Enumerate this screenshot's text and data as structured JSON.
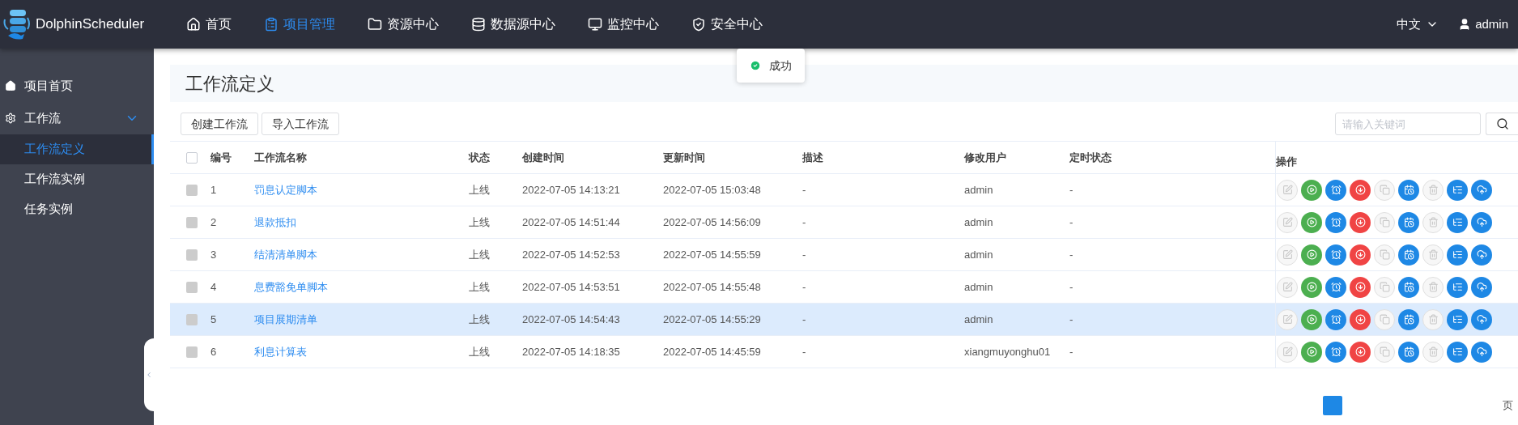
{
  "header": {
    "brand": "DolphinScheduler",
    "nav": [
      {
        "kind": "home",
        "label": "首页",
        "selected": false
      },
      {
        "kind": "project",
        "label": "项目管理",
        "selected": true
      },
      {
        "kind": "resource",
        "label": "资源中心",
        "selected": false
      },
      {
        "kind": "datasource",
        "label": "数据源中心",
        "selected": false
      },
      {
        "kind": "monitor",
        "label": "监控中心",
        "selected": false
      },
      {
        "kind": "security",
        "label": "安全中心",
        "selected": false
      }
    ],
    "language": "中文",
    "user": "admin"
  },
  "toast": {
    "kind": "success",
    "message": "成功"
  },
  "sidebar": {
    "items": [
      {
        "kind": "home",
        "label": "项目首页",
        "selected": false
      },
      {
        "kind": "gear",
        "label": "工作流",
        "expanded": true,
        "children": [
          {
            "label": "工作流定义",
            "selected": true
          },
          {
            "label": "工作流实例",
            "selected": false
          },
          {
            "label": "任务实例",
            "selected": false
          }
        ]
      }
    ]
  },
  "page": {
    "title": "工作流定义",
    "buttons": [
      "创建工作流",
      "导入工作流"
    ],
    "search": {
      "placeholder": "请输入关键词"
    }
  },
  "table": {
    "columns": [
      "编号",
      "工作流名称",
      "状态",
      "创建时间",
      "更新时间",
      "描述",
      "修改用户",
      "定时状态",
      "操作"
    ],
    "header_checked": false,
    "actions": [
      {
        "kind": "edit",
        "disabled": true
      },
      {
        "kind": "run",
        "disabled": false
      },
      {
        "kind": "timer",
        "disabled": false
      },
      {
        "kind": "offline",
        "disabled": false
      },
      {
        "kind": "copy",
        "disabled": true
      },
      {
        "kind": "schedule",
        "disabled": false
      },
      {
        "kind": "delete",
        "disabled": true
      },
      {
        "kind": "tree",
        "disabled": false
      },
      {
        "kind": "export",
        "disabled": false
      }
    ],
    "rows": [
      {
        "id": "1",
        "name": "罚息认定脚本",
        "state": "上线",
        "created": "2022-07-05 14:13:21",
        "updated": "2022-07-05 15:03:48",
        "description": "-",
        "user": "admin",
        "schedule": "-",
        "selected": false,
        "checkbox_disabled": true
      },
      {
        "id": "2",
        "name": "退款抵扣",
        "state": "上线",
        "created": "2022-07-05 14:51:44",
        "updated": "2022-07-05 14:56:09",
        "description": "-",
        "user": "admin",
        "schedule": "-",
        "selected": false,
        "checkbox_disabled": true
      },
      {
        "id": "3",
        "name": "结清清单脚本",
        "state": "上线",
        "created": "2022-07-05 14:52:53",
        "updated": "2022-07-05 14:55:59",
        "description": "-",
        "user": "admin",
        "schedule": "-",
        "selected": false,
        "checkbox_disabled": true
      },
      {
        "id": "4",
        "name": "息费豁免单脚本",
        "state": "上线",
        "created": "2022-07-05 14:53:51",
        "updated": "2022-07-05 14:55:48",
        "description": "-",
        "user": "admin",
        "schedule": "-",
        "selected": false,
        "checkbox_disabled": true
      },
      {
        "id": "5",
        "name": "项目展期清单",
        "state": "上线",
        "created": "2022-07-05 14:54:43",
        "updated": "2022-07-05 14:55:29",
        "description": "-",
        "user": "admin",
        "schedule": "-",
        "selected": true,
        "checkbox_disabled": true
      },
      {
        "id": "6",
        "name": "利息计算表",
        "state": "上线",
        "created": "2022-07-05 14:18:35",
        "updated": "2022-07-05 14:45:59",
        "description": "-",
        "user": "xiangmuyonghu01",
        "schedule": "-",
        "selected": false,
        "checkbox_disabled": true
      }
    ]
  },
  "pagination": {
    "suffix": "页"
  }
}
